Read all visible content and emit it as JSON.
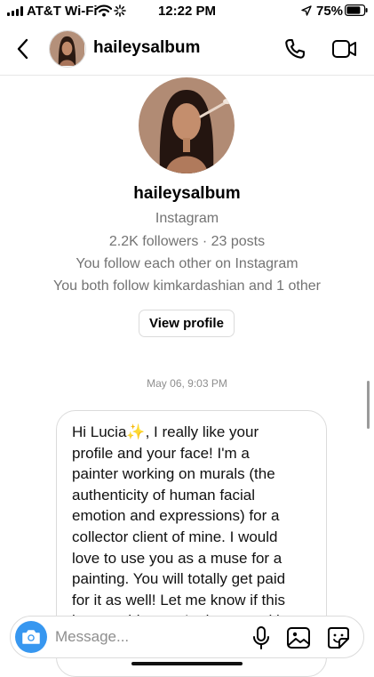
{
  "status_bar": {
    "carrier": "AT&T Wi-Fi",
    "time": "12:22 PM",
    "battery": "75%"
  },
  "header": {
    "username": "haileysalbum",
    "icons": [
      "back-chevron-icon",
      "phone-icon",
      "video-camera-icon"
    ]
  },
  "profile": {
    "name": "haileysalbum",
    "platform": "Instagram",
    "stats": "2.2K followers · 23 posts",
    "mutual_follow": "You follow each other on Instagram",
    "mutual_friends": "You both follow kimkardashian and 1 other",
    "view_profile_label": "View profile"
  },
  "conversation": {
    "timestamp": "May 06, 9:03 PM",
    "message": "Hi Lucia✨, I really like your\nprofile and your face! I'm a\npainter working on murals (the\nauthenticity of human facial\nemotion and expressions) for a\ncollector client of mine. I would\nlove to use you as a muse for a\npainting. You will totally get paid\nfor it as well! Let me know if this\nis something you're interested in"
  },
  "composer": {
    "placeholder": "Message...",
    "value": "",
    "icons": [
      "camera-icon",
      "microphone-icon",
      "gallery-icon",
      "sticker-icon"
    ]
  },
  "colors": {
    "accent": "#3797f0",
    "secondary_text": "#737373",
    "border": "#dbdbdb"
  }
}
